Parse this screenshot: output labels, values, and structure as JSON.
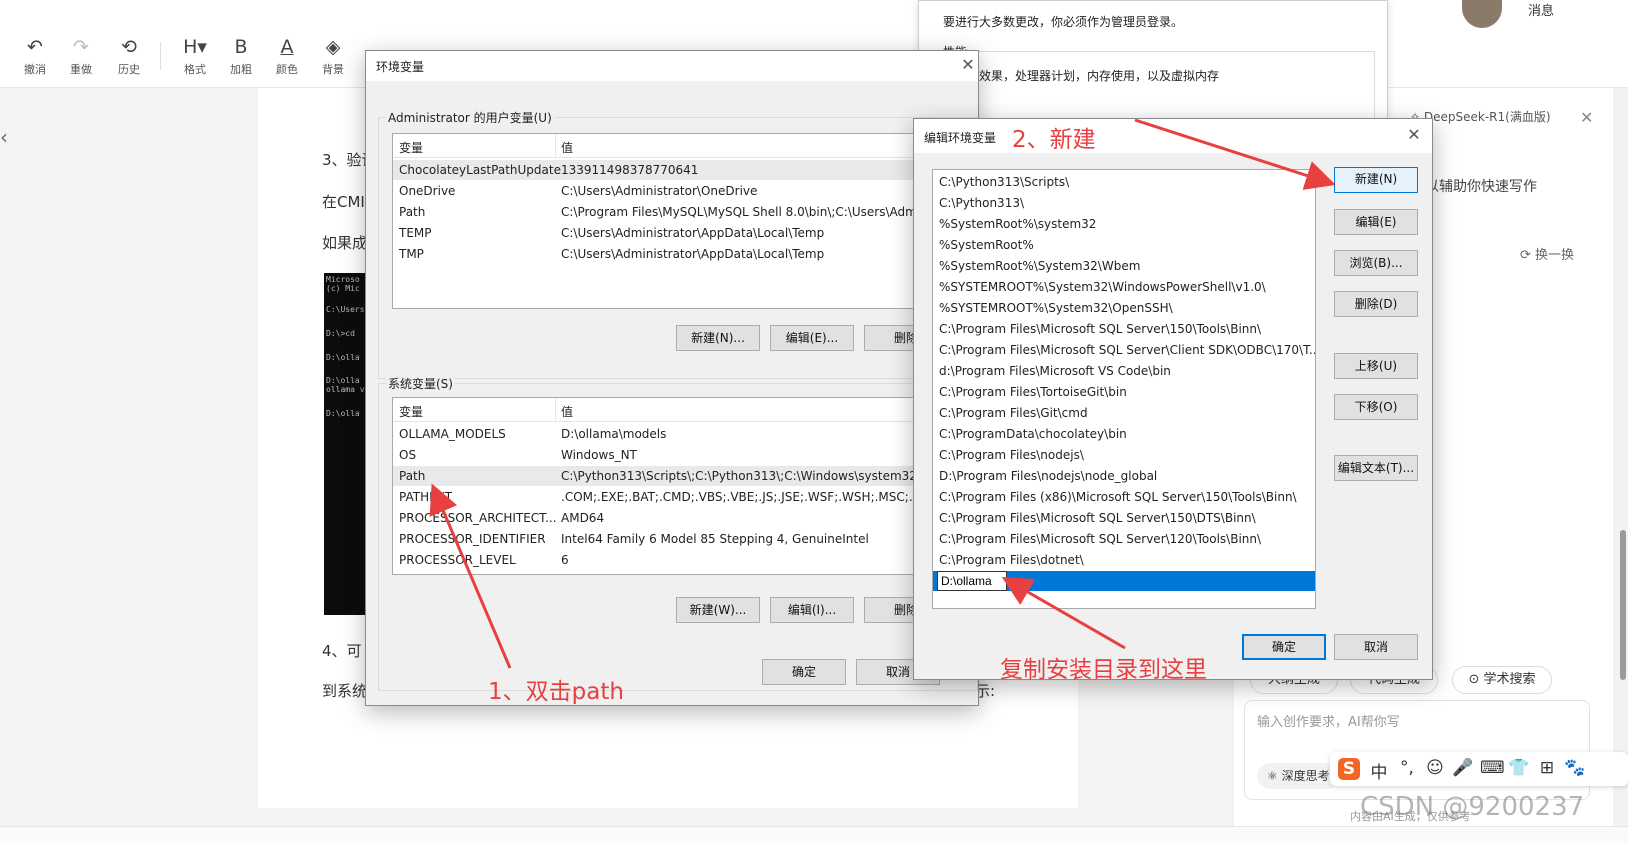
{
  "toolbar": {
    "items": [
      {
        "label": "撤消",
        "icon": "undo-icon",
        "glyph": "↶"
      },
      {
        "label": "重做",
        "icon": "redo-icon",
        "glyph": "↷"
      },
      {
        "label": "历史",
        "icon": "history-icon",
        "glyph": "⟲"
      },
      {
        "label": "格式",
        "icon": "heading-icon",
        "glyph": "H▾"
      },
      {
        "label": "加粗",
        "icon": "bold-icon",
        "glyph": "B"
      },
      {
        "label": "颜色",
        "icon": "font-color-icon",
        "glyph": "A"
      },
      {
        "label": "背景",
        "icon": "paint-bucket-icon",
        "glyph": "◈"
      }
    ]
  },
  "header": {
    "messages_label": "消息"
  },
  "sys_dialog": {
    "admin_note": "要进行大多数更改，你必须作为管理员登录。",
    "perf_label": "性能",
    "perf_desc": "视觉效果，处理器计划，内存使用，以及虚拟内存"
  },
  "document": {
    "lines": [
      "3、验证",
      "在CMI",
      "如果成",
      "4、可",
      "到系统",
      "示:"
    ],
    "cmd_lines": [
      "Microso",
      "(c) Mic",
      "C:\\Users",
      "D:\\>cd",
      "D:\\olla",
      "D:\\olla",
      "ollama v",
      "D:\\olla"
    ]
  },
  "env_dialog": {
    "title": "环境变量",
    "user_group": "Administrator 的用户变量(U)",
    "col_var": "变量",
    "col_val": "值",
    "user_vars": [
      {
        "name": "ChocolateyLastPathUpdate",
        "value": "133911498378770641"
      },
      {
        "name": "OneDrive",
        "value": "C:\\Users\\Administrator\\OneDrive"
      },
      {
        "name": "Path",
        "value": "C:\\Program Files\\MySQL\\MySQL Shell 8.0\\bin\\;C:\\Users\\Adm"
      },
      {
        "name": "TEMP",
        "value": "C:\\Users\\Administrator\\AppData\\Local\\Temp"
      },
      {
        "name": "TMP",
        "value": "C:\\Users\\Administrator\\AppData\\Local\\Temp"
      }
    ],
    "user_buttons": [
      "新建(N)...",
      "编辑(E)...",
      "删除"
    ],
    "sys_group": "系统变量(S)",
    "sys_vars": [
      {
        "name": "OLLAMA_MODELS",
        "value": "D:\\ollama\\models"
      },
      {
        "name": "OS",
        "value": "Windows_NT"
      },
      {
        "name": "Path",
        "value": "C:\\Python313\\Scripts\\;C:\\Python313\\;C:\\Windows\\system32;C"
      },
      {
        "name": "PATHEXT",
        "value": ".COM;.EXE;.BAT;.CMD;.VBS;.VBE;.JS;.JSE;.WSF;.WSH;.MSC;.PY;"
      },
      {
        "name": "PROCESSOR_ARCHITECT...",
        "value": "AMD64"
      },
      {
        "name": "PROCESSOR_IDENTIFIER",
        "value": "Intel64 Family 6 Model 85 Stepping 4, GenuineIntel"
      },
      {
        "name": "PROCESSOR_LEVEL",
        "value": "6"
      }
    ],
    "sys_buttons": [
      "新建(W)...",
      "编辑(I)...",
      "删除"
    ],
    "ok": "确定",
    "cancel": "取消"
  },
  "edit_dialog": {
    "title": "编辑环境变量",
    "paths": [
      "C:\\Python313\\Scripts\\",
      "C:\\Python313\\",
      "%SystemRoot%\\system32",
      "%SystemRoot%",
      "%SystemRoot%\\System32\\Wbem",
      "%SYSTEMROOT%\\System32\\WindowsPowerShell\\v1.0\\",
      "%SYSTEMROOT%\\System32\\OpenSSH\\",
      "C:\\Program Files\\Microsoft SQL Server\\150\\Tools\\Binn\\",
      "C:\\Program Files\\Microsoft SQL Server\\Client SDK\\ODBC\\170\\T...",
      "d:\\Program Files\\Microsoft VS Code\\bin",
      "C:\\Program Files\\TortoiseGit\\bin",
      "C:\\Program Files\\Git\\cmd",
      "C:\\ProgramData\\chocolatey\\bin",
      "C:\\Program Files\\nodejs\\",
      "D:\\Program Files\\nodejs\\node_global",
      "C:\\Program Files (x86)\\Microsoft SQL Server\\150\\Tools\\Binn\\",
      "C:\\Program Files\\Microsoft SQL Server\\150\\DTS\\Binn\\",
      "C:\\Program Files\\Microsoft SQL Server\\120\\Tools\\Binn\\",
      "C:\\Program Files\\dotnet\\"
    ],
    "new_entry": "D:\\ollama",
    "buttons": {
      "new": "新建(N)",
      "edit": "编辑(E)",
      "browse": "浏览(B)...",
      "delete": "删除(D)",
      "up": "上移(U)",
      "down": "下移(O)",
      "edit_text": "编辑文本(T)..."
    },
    "ok": "确定",
    "cancel": "取消"
  },
  "annotations": {
    "step1": "1、双击path",
    "step2": "2、新建",
    "step3": "复制安装目录到这里",
    "arrow_color": "#e84040"
  },
  "assistant": {
    "model": "DeepSeek-R1(满血版)",
    "tagline": "以辅助你快速写作",
    "refresh": "换一换",
    "chips": [
      "大纲生成",
      "代码生成",
      "学术搜索"
    ],
    "input_placeholder": "输入创作要求，AI帮你写",
    "deep_think": "深度思考",
    "footer": "内容由AI生成，仅供参考"
  },
  "ime": {
    "items": [
      "S",
      "中",
      "°,",
      "☺",
      "🎤",
      "⌨",
      "👕",
      "⊞",
      "🐾"
    ]
  },
  "watermark": "CSDN @9200237"
}
